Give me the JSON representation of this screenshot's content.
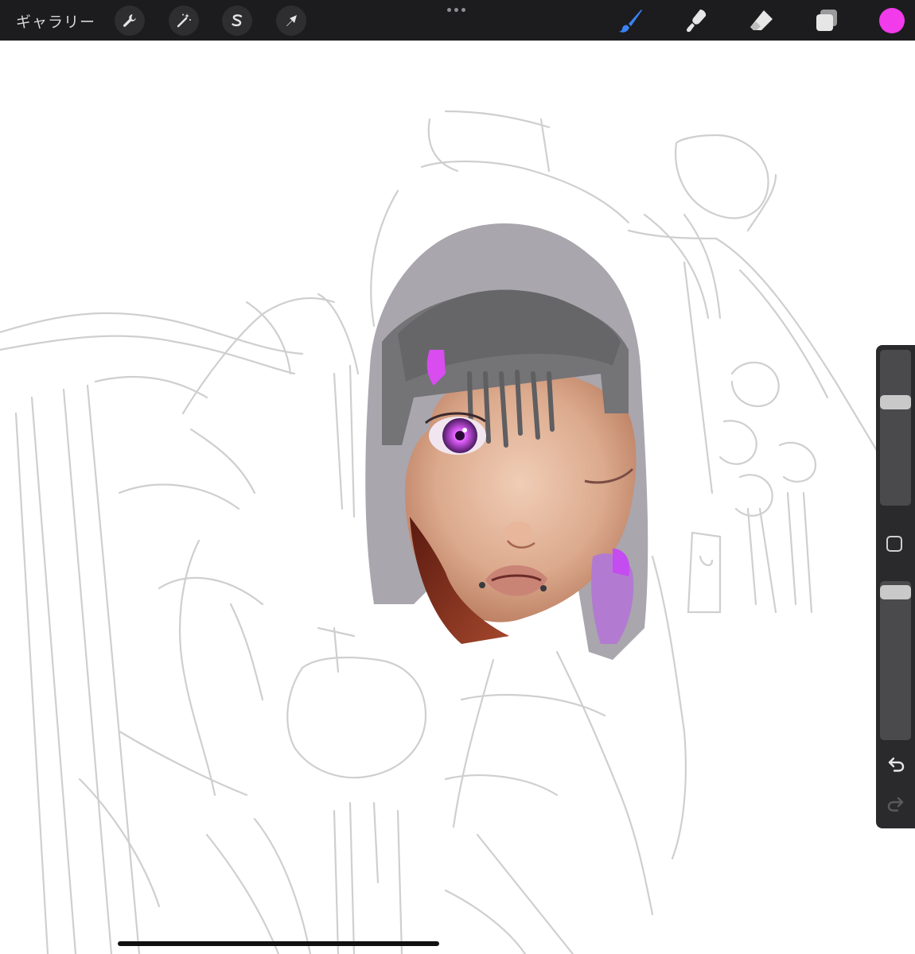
{
  "toolbar": {
    "gallery_label": "ギャラリー",
    "left_tools": [
      "wrench-icon",
      "magic-wand-icon",
      "selection-s-icon",
      "arrow-transform-icon"
    ],
    "right_tools": [
      "brush-icon",
      "smudge-icon",
      "eraser-icon",
      "layers-icon"
    ],
    "active_tool": "brush-icon",
    "current_color": "#f23bea",
    "accent_color": "#3a82f6"
  },
  "sidebar": {
    "brush_size_level": 0.68,
    "opacity_level": 0.97,
    "icons": [
      "modifier-square-icon",
      "undo-icon",
      "redo-icon"
    ]
  }
}
